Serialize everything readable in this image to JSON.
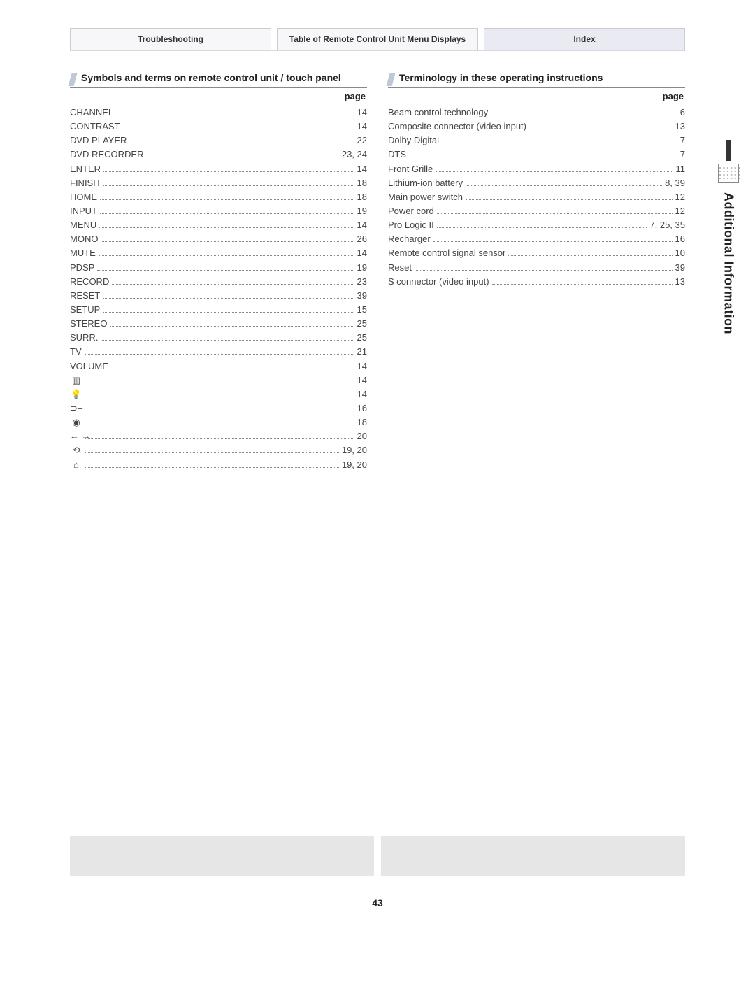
{
  "tabs": [
    {
      "label": "Troubleshooting"
    },
    {
      "label": "Table of Remote Control Unit Menu Displays"
    },
    {
      "label": "Index"
    }
  ],
  "left": {
    "title": "Symbols and terms on remote control unit / touch panel",
    "page_label": "page",
    "entries": [
      {
        "term": "CHANNEL",
        "page": "14"
      },
      {
        "term": "CONTRAST",
        "page": "14"
      },
      {
        "term": "DVD PLAYER",
        "page": "22"
      },
      {
        "term": "DVD RECORDER",
        "page": "23, 24"
      },
      {
        "term": "ENTER",
        "page": "14"
      },
      {
        "term": "FINISH",
        "page": "18"
      },
      {
        "term": "HOME",
        "page": "18"
      },
      {
        "term": "INPUT",
        "page": "19"
      },
      {
        "term": "MENU",
        "page": "14"
      },
      {
        "term": "MONO",
        "page": "26"
      },
      {
        "term": "MUTE",
        "page": "14"
      },
      {
        "term": "PDSP",
        "page": "19"
      },
      {
        "term": "RECORD",
        "page": "23"
      },
      {
        "term": "RESET",
        "page": "39"
      },
      {
        "term": "SETUP",
        "page": "15"
      },
      {
        "term": "STEREO",
        "page": "25"
      },
      {
        "term": "SURR.",
        "page": "25"
      },
      {
        "term": "TV",
        "page": "21"
      },
      {
        "term": "VOLUME",
        "page": "14"
      },
      {
        "symbol": "▥",
        "page": "14"
      },
      {
        "symbol": "💡",
        "page": "14"
      },
      {
        "symbol": "⊃–",
        "page": "16"
      },
      {
        "symbol": "◉",
        "page": "18"
      },
      {
        "symbol": "← →",
        "page": "20"
      },
      {
        "symbol": "⟲",
        "page": "19, 20"
      },
      {
        "symbol": "⌂",
        "page": "19, 20"
      }
    ]
  },
  "right": {
    "title": "Terminology in these operating instructions",
    "page_label": "page",
    "entries": [
      {
        "term": "Beam control technology",
        "page": "6"
      },
      {
        "term": "Composite connector (video input)",
        "page": "13"
      },
      {
        "term": "Dolby Digital",
        "page": "7"
      },
      {
        "term": "DTS",
        "page": "7"
      },
      {
        "term": "Front Grille",
        "page": "11"
      },
      {
        "term": "Lithium-ion battery",
        "page": "8, 39"
      },
      {
        "term": "Main power switch",
        "page": "12"
      },
      {
        "term": "Power cord",
        "page": "12"
      },
      {
        "term": "Pro Logic II",
        "page": "7, 25, 35"
      },
      {
        "term": "Recharger",
        "page": "16"
      },
      {
        "term": "Remote control signal sensor",
        "page": "10"
      },
      {
        "term": "Reset",
        "page": "39"
      },
      {
        "term": "S connector (video input)",
        "page": "13"
      }
    ]
  },
  "side_tab": "Additional Information",
  "page_number": "43"
}
